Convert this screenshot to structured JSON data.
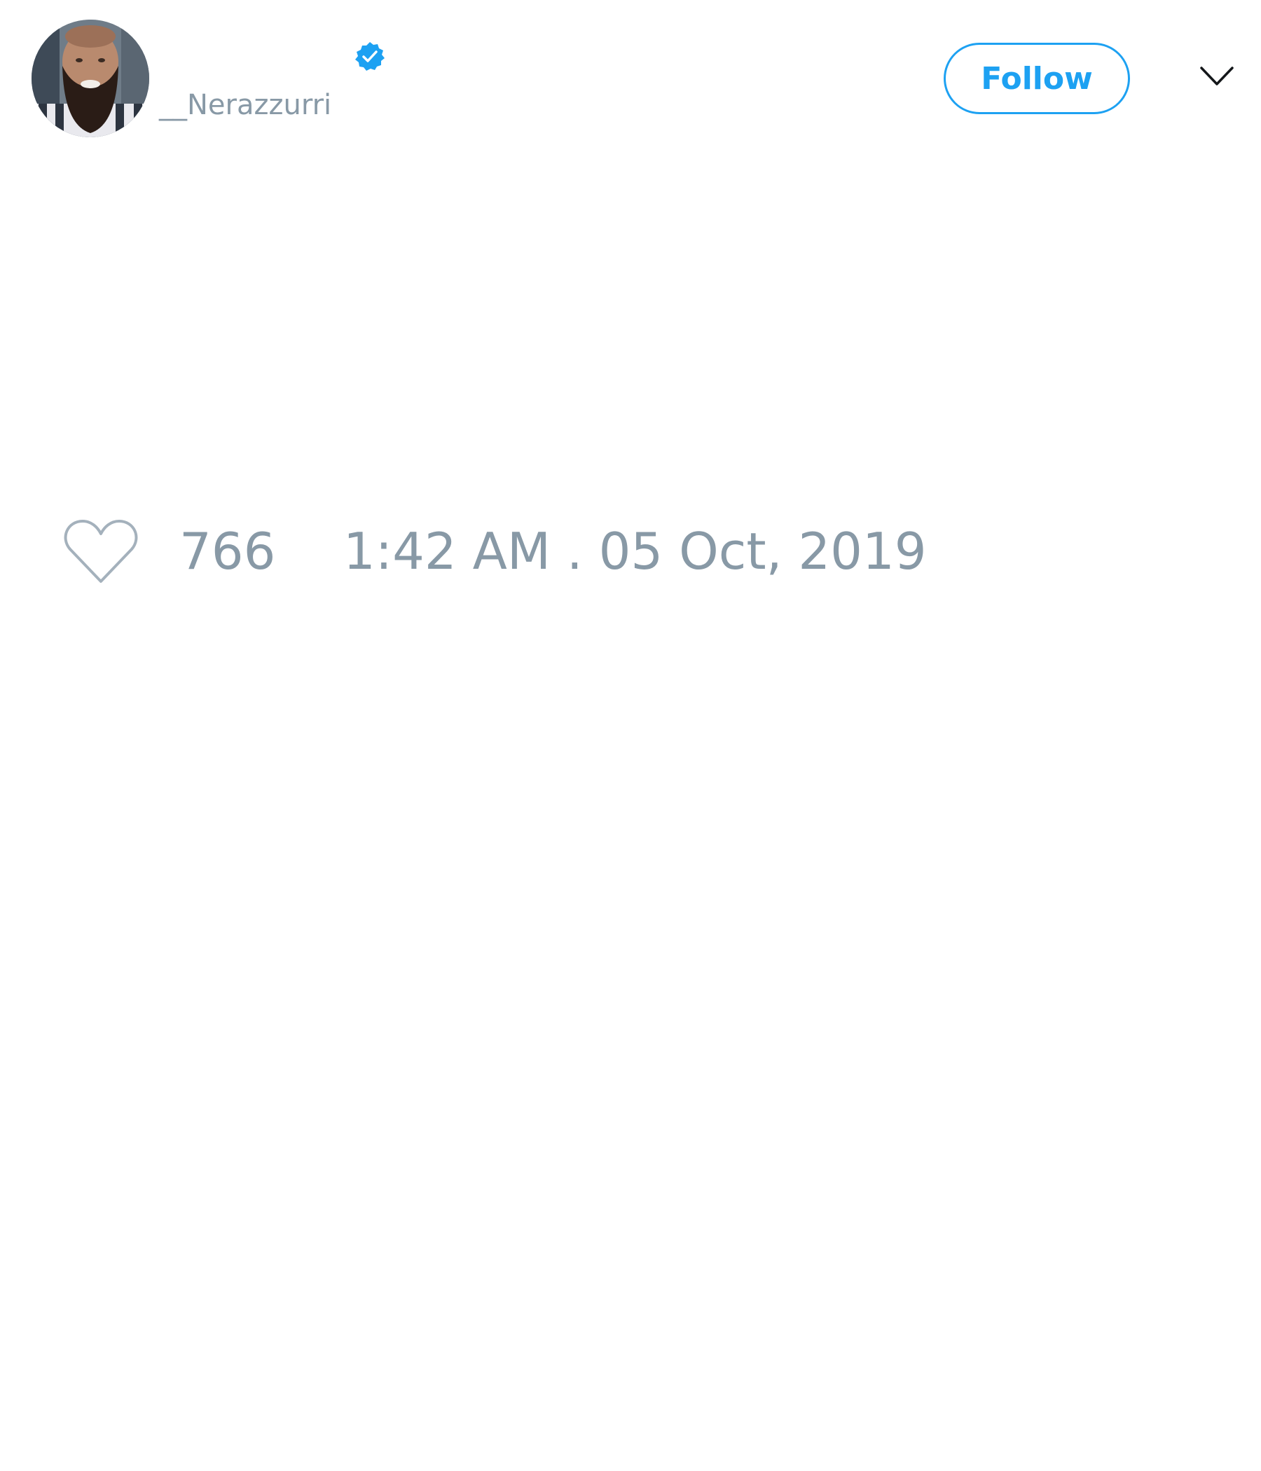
{
  "tweet": {
    "author": {
      "handle": "__Nerazzurri",
      "verified": true,
      "avatar": "bearded-man-photo"
    },
    "follow_label": "Follow",
    "menu_icon": "chevron-down-icon",
    "likes": {
      "icon": "heart-icon",
      "count": "766"
    },
    "timestamp": "1:42 AM . 05 Oct, 2019"
  },
  "colors": {
    "accent": "#1da1f2",
    "muted_text": "#8899a6",
    "background": "#ffffff"
  }
}
